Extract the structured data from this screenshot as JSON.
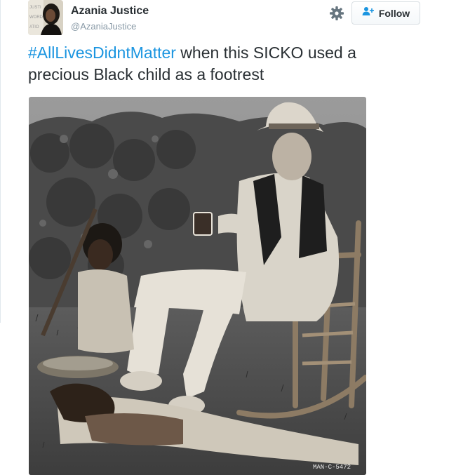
{
  "user": {
    "display_name": "Azania Justice",
    "handle": "@AzaniaJustice",
    "avatar_icon": "profile-photo"
  },
  "actions": {
    "settings_icon": "gear-icon",
    "follow_label": "Follow",
    "follow_icon": "add-user-icon"
  },
  "tweet": {
    "hashtag": "#AllLivesDidntMatter",
    "text": " when this SICKO used a precious Black child as a footrest"
  },
  "photo": {
    "caption_mark": "MAN-C-5472",
    "description_icon": "black-and-white-photo"
  },
  "colors": {
    "hashtag": "#1b95e0",
    "text": "#292f33",
    "muted": "#8899a6"
  }
}
